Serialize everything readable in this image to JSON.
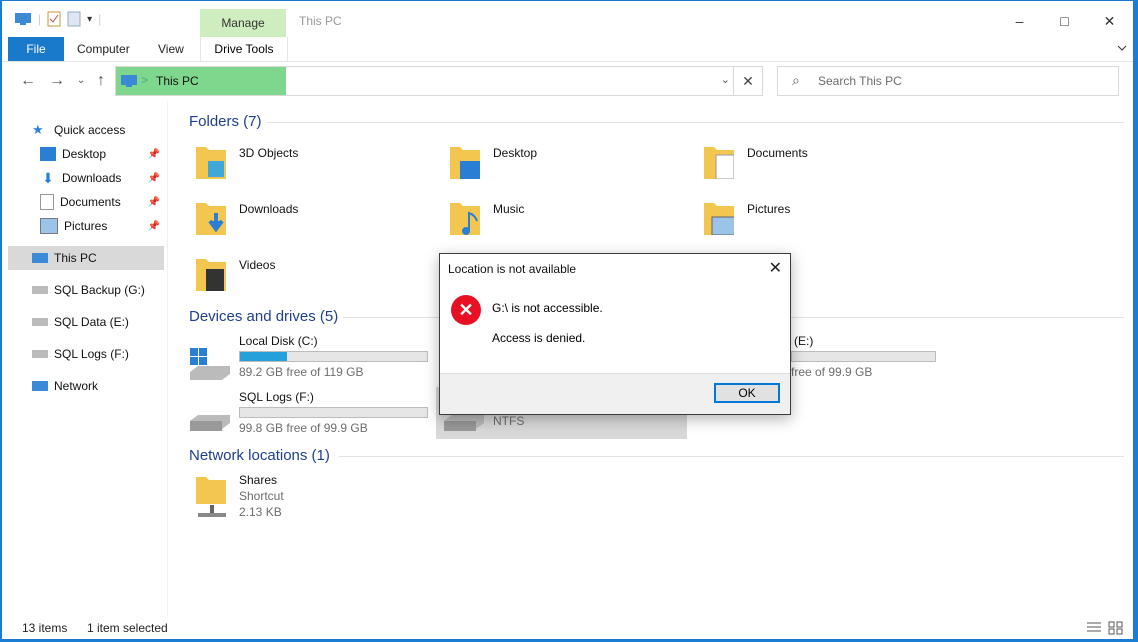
{
  "window": {
    "title": "This PC",
    "contextual_tab_group": "Manage",
    "controls": {
      "minimize": "–",
      "maximize": "□",
      "close": "✕"
    }
  },
  "ribbon": {
    "tabs": [
      {
        "label": "File"
      },
      {
        "label": "Computer"
      },
      {
        "label": "View"
      },
      {
        "label": "Drive Tools"
      }
    ],
    "collapse_icon": "chevron-down"
  },
  "address_bar": {
    "location": "This PC",
    "separator": ">",
    "dropdown": "⌄",
    "clear": "✕"
  },
  "search": {
    "placeholder": "Search This PC"
  },
  "nav_pane": {
    "quick_access": "Quick access",
    "pinned": [
      {
        "label": "Desktop"
      },
      {
        "label": "Downloads"
      },
      {
        "label": "Documents"
      },
      {
        "label": "Pictures"
      }
    ],
    "this_pc": "This PC",
    "drives": [
      {
        "label": "SQL Backup (G:)"
      },
      {
        "label": "SQL Data (E:)"
      },
      {
        "label": "SQL Logs (F:)"
      }
    ],
    "network": "Network"
  },
  "folders": {
    "header": "Folders (7)",
    "items": [
      {
        "name": "3D Objects"
      },
      {
        "name": "Desktop"
      },
      {
        "name": "Documents"
      },
      {
        "name": "Downloads"
      },
      {
        "name": "Music"
      },
      {
        "name": "Pictures"
      },
      {
        "name": "Videos"
      }
    ]
  },
  "devices": {
    "header": "Devices and drives (5)",
    "items": [
      {
        "name": "Local Disk (C:)",
        "free": "89.2 GB free of 119 GB",
        "used_fraction": 0.25
      },
      {
        "name": "a (E:)",
        "free": "free of 99.9 GB",
        "used_fraction": 0.0
      },
      {
        "name": "SQL Logs (F:)",
        "free": "99.8 GB free of 99.9 GB",
        "used_fraction": 0.0
      },
      {
        "name": "NTFS",
        "free": ""
      }
    ]
  },
  "network_locations": {
    "header": "Network locations (1)",
    "items": [
      {
        "name": "Shares",
        "type": "Shortcut",
        "size": "2.13 KB"
      }
    ]
  },
  "dialog": {
    "title": "Location is not available",
    "message": "G:\\ is not accessible.",
    "detail": "Access is denied.",
    "ok": "OK",
    "close": "✕",
    "error_glyph": "✕"
  },
  "status_bar": {
    "items_count": "13 items",
    "selection": "1 item selected"
  },
  "colors": {
    "accent": "#1979ca",
    "address_highlight": "#7fd68d",
    "manage_tab": "#cfeec0",
    "error_red": "#e81123",
    "progress": "#26a0da"
  }
}
